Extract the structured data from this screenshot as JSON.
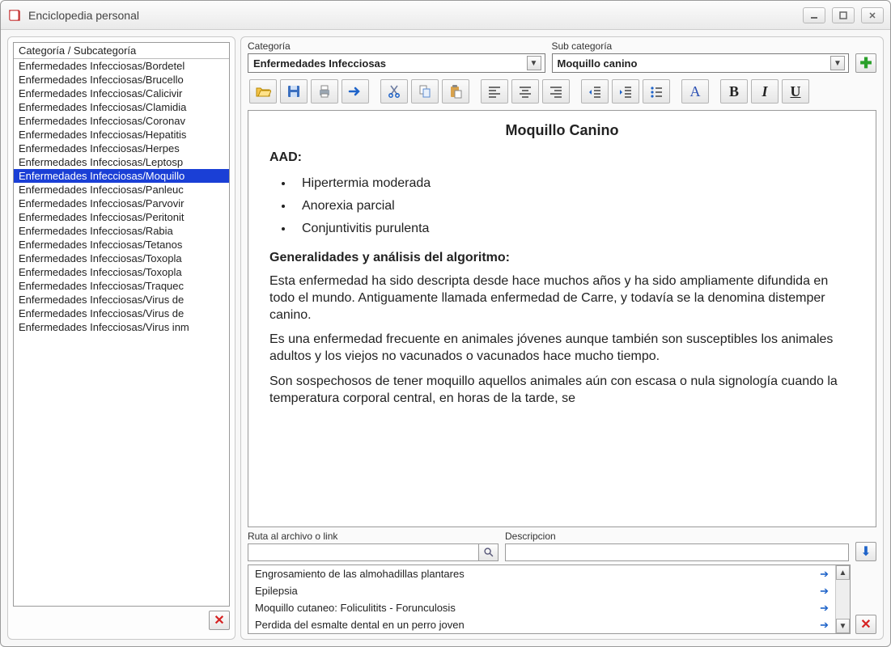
{
  "window": {
    "title": "Enciclopedia personal"
  },
  "sidebar": {
    "header": "Categoría / Subcategoría",
    "items": [
      {
        "label": "Enfermedades Infecciosas/Bordetel"
      },
      {
        "label": "Enfermedades Infecciosas/Brucello"
      },
      {
        "label": "Enfermedades Infecciosas/Calicivir"
      },
      {
        "label": "Enfermedades Infecciosas/Clamidia"
      },
      {
        "label": "Enfermedades Infecciosas/Coronav"
      },
      {
        "label": "Enfermedades Infecciosas/Hepatitis"
      },
      {
        "label": "Enfermedades Infecciosas/Herpes"
      },
      {
        "label": "Enfermedades Infecciosas/Leptosp"
      },
      {
        "label": "Enfermedades Infecciosas/Moquillo",
        "selected": true
      },
      {
        "label": "Enfermedades Infecciosas/Panleuc"
      },
      {
        "label": "Enfermedades Infecciosas/Parvovir"
      },
      {
        "label": "Enfermedades Infecciosas/Peritonit"
      },
      {
        "label": "Enfermedades Infecciosas/Rabia"
      },
      {
        "label": "Enfermedades Infecciosas/Tetanos"
      },
      {
        "label": "Enfermedades Infecciosas/Toxopla"
      },
      {
        "label": "Enfermedades Infecciosas/Toxopla"
      },
      {
        "label": "Enfermedades Infecciosas/Traquec"
      },
      {
        "label": "Enfermedades Infecciosas/Virus de"
      },
      {
        "label": "Enfermedades Infecciosas/Virus de"
      },
      {
        "label": "Enfermedades Infecciosas/Virus inm"
      }
    ]
  },
  "category": {
    "label": "Categoría",
    "value": "Enfermedades Infecciosas"
  },
  "subcategory": {
    "label": "Sub categoría",
    "value": "Moquillo canino"
  },
  "toolbar": {
    "bold": "B",
    "italic": "I",
    "underline": "U",
    "font": "A"
  },
  "article": {
    "title": "Moquillo Canino",
    "aad_label": "AAD:",
    "bullets": [
      "Hipertermia moderada",
      "Anorexia parcial",
      "Conjuntivitis purulenta"
    ],
    "section2_title": "Generalidades y análisis del algoritmo:",
    "p1": "Esta enfermedad ha sido descripta desde hace muchos años y ha sido ampliamente difundida en todo el mundo. Antiguamente llamada enfermedad de Carre, y todavía se la denomina distemper canino.",
    "p2": "Es una enfermedad frecuente en animales jóvenes aunque también son susceptibles los animales adultos y los viejos no vacunados o vacunados hace mucho tiempo.",
    "p3": "Son sospechosos de tener moquillo aquellos animales aún con escasa o nula signología cuando la temperatura corporal central, en horas de la tarde, se"
  },
  "link": {
    "path_label": "Ruta al archivo o link",
    "desc_label": "Descripcion"
  },
  "related": [
    "Engrosamiento de las almohadillas plantares",
    "Epilepsia",
    "Moquillo cutaneo: Foliculitits - Forunculosis",
    "Perdida del esmalte dental en un perro joven"
  ]
}
